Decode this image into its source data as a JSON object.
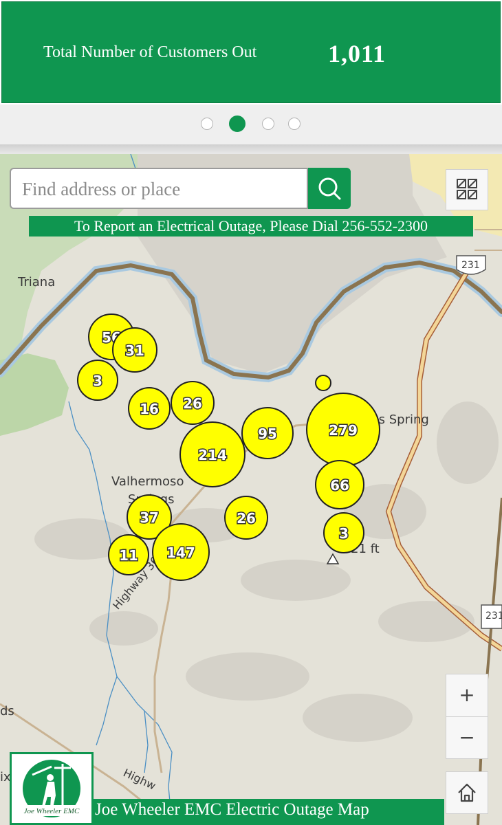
{
  "banner": {
    "label": "Total Number of Customers Out",
    "value": "1,011",
    "color": "#0f9650"
  },
  "pager": {
    "count": 4,
    "active_index": 1
  },
  "search": {
    "placeholder": "Find address or place",
    "icon": "search-icon"
  },
  "report_bar": {
    "text": "To Report an Electrical Outage, Please Dial 256-552-2300"
  },
  "map_labels": {
    "triana": "Triana",
    "valhermoso": "Valhermoso",
    "springs": "Springs",
    "spring": "ys Spring",
    "elevation": "21 ft",
    "highway_36e": "Highway 36 E",
    "highway": "Highw",
    "route_231_a": "231",
    "route_231_b": "231",
    "edge_ds": "ds",
    "edge_ix": "ix"
  },
  "outages": [
    {
      "count": "56"
    },
    {
      "count": "31"
    },
    {
      "count": "3"
    },
    {
      "count": "16"
    },
    {
      "count": "26"
    },
    {
      "count": "214"
    },
    {
      "count": "95"
    },
    {
      "count": ""
    },
    {
      "count": "279"
    },
    {
      "count": "66"
    },
    {
      "count": "3"
    },
    {
      "count": "37"
    },
    {
      "count": "26"
    },
    {
      "count": "11"
    },
    {
      "count": "147"
    }
  ],
  "controls": {
    "zoom_in": "+",
    "zoom_out": "−",
    "home_icon": "home-icon",
    "basemap_icon": "basemap-gallery-icon"
  },
  "footer": {
    "title": "Joe Wheeler EMC Electric Outage Map",
    "logo_text": "Joe Wheeler EMC"
  },
  "colors": {
    "brand": "#0f9650",
    "outage_fill": "#ffff00",
    "river": "#8a7450"
  }
}
